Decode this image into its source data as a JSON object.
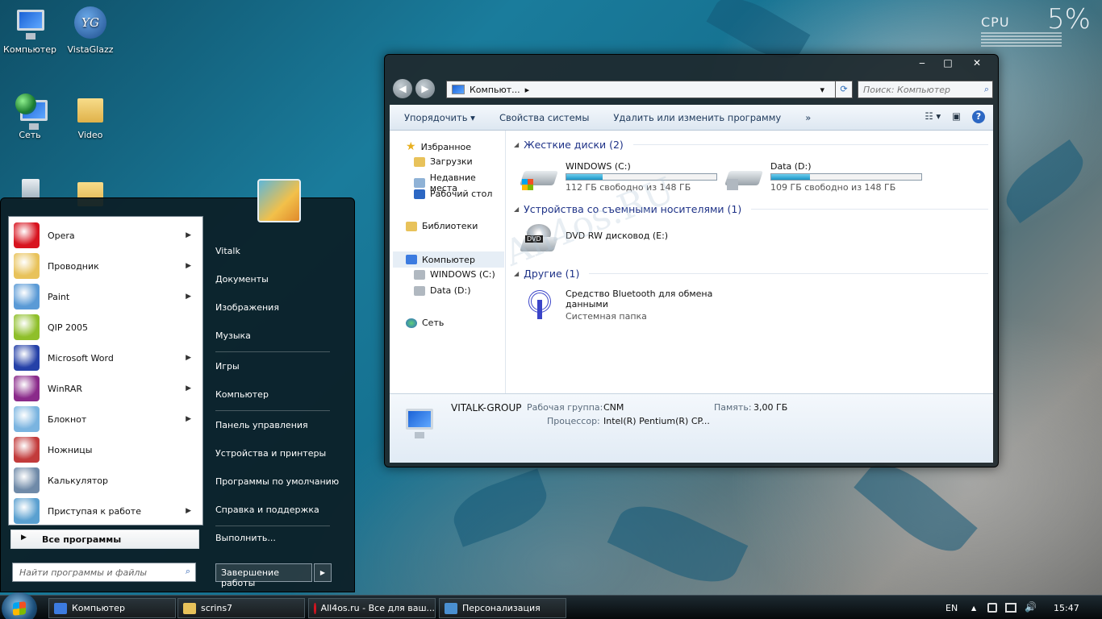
{
  "desktop": {
    "icons": [
      {
        "label": "Компьютер"
      },
      {
        "label": "VistaGlazz"
      },
      {
        "label": "Сеть"
      },
      {
        "label": "Video"
      }
    ],
    "vg_glyph": "YG",
    "cpu": {
      "label": "CPU",
      "value": "5%"
    },
    "watermark": "All4os.RU"
  },
  "explorer": {
    "window_buttons": {
      "minimize": "‒",
      "maximize": "□",
      "close": "✕"
    },
    "address": "Компьют...",
    "search_placeholder": "Поиск: Компьютер",
    "toolbar": {
      "organize": "Упорядочить",
      "system_properties": "Свойства системы",
      "uninstall": "Удалить или изменить программу",
      "more": "»"
    },
    "nav": {
      "favorites": "Избранное",
      "downloads": "Загрузки",
      "recent": "Недавние места",
      "desktop": "Рабочий стол",
      "libraries": "Библиотеки",
      "computer": "Компьютер",
      "drive_c": "WINDOWS (C:)",
      "drive_d": "Data (D:)",
      "network": "Сеть"
    },
    "groups": {
      "hdd": "Жесткие диски (2)",
      "removable": "Устройства со съемными носителями (1)",
      "other": "Другие (1)"
    },
    "drives": [
      {
        "name": "WINDOWS (C:)",
        "free": "112 ГБ свободно из 148 ГБ",
        "used_fraction": 0.24
      },
      {
        "name": "Data (D:)",
        "free": "109 ГБ свободно из 148 ГБ",
        "used_fraction": 0.26
      }
    ],
    "dvd": {
      "name": "DVD RW дисковод (E:)",
      "badge": "DVD"
    },
    "bluetooth": {
      "name_line1": "Средство Bluetooth для обмена",
      "name_line2": "данными",
      "type": "Системная папка"
    },
    "details": {
      "computer_name": "VITALK-GROUP",
      "workgroup_label": "Рабочая группа:",
      "workgroup": "CNM",
      "memory_label": "Память:",
      "memory": "3,00 ГБ",
      "cpu_label": "Процессор:",
      "cpu": "Intel(R) Pentium(R) CP..."
    }
  },
  "start_menu": {
    "programs": [
      {
        "label": "Opera",
        "submenu": true,
        "color": "#d8141f"
      },
      {
        "label": "Проводник",
        "submenu": true,
        "color": "#e8c25a"
      },
      {
        "label": "Paint",
        "submenu": true,
        "color": "#5a9ad6"
      },
      {
        "label": "QIP 2005",
        "submenu": false,
        "color": "#8fbf2a"
      },
      {
        "label": "Microsoft Word",
        "submenu": true,
        "color": "#2541a8"
      },
      {
        "label": "WinRAR",
        "submenu": true,
        "color": "#8a2a8a"
      },
      {
        "label": "Блокнот",
        "submenu": true,
        "color": "#7ab4e0"
      },
      {
        "label": "Ножницы",
        "submenu": false,
        "color": "#c23b3b"
      },
      {
        "label": "Калькулятор",
        "submenu": false,
        "color": "#6f8aa8"
      },
      {
        "label": "Приступая к работе",
        "submenu": true,
        "color": "#5aa0d0"
      }
    ],
    "all_programs": "Все программы",
    "search_placeholder": "Найти программы и файлы",
    "right": [
      "Vitalk",
      "Документы",
      "Изображения",
      "Музыка",
      "Игры",
      "Компьютер",
      "Панель управления",
      "Устройства и принтеры",
      "Программы по умолчанию",
      "Справка и поддержка",
      "Выполнить..."
    ],
    "shutdown": "Завершение работы",
    "shutdown_arrow": "▶"
  },
  "taskbar": {
    "buttons": [
      {
        "label": "Компьютер",
        "color": "#3c7be0"
      },
      {
        "label": "scrins7",
        "color": "#e8c25a"
      },
      {
        "label": "All4os.ru - Все для ваш...",
        "color": "#d8141f"
      },
      {
        "label": "Персонализация",
        "color": "#4a8fd0"
      }
    ],
    "lang": "EN",
    "tray_arrow": "▲",
    "volume": "🔊",
    "clock": "15:47"
  }
}
